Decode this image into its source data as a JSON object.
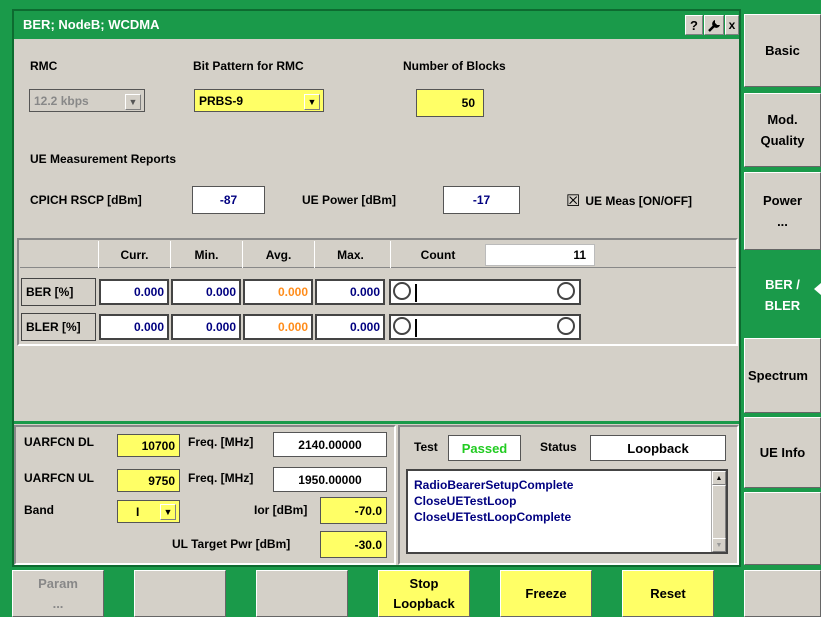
{
  "window": {
    "title": "BER; NodeB; WCDMA",
    "help_icon_glyph": "?",
    "close_glyph": "x"
  },
  "rmc": {
    "label": "RMC",
    "value": "12.2 kbps"
  },
  "bit_pattern": {
    "label": "Bit Pattern for RMC",
    "value": "PRBS-9"
  },
  "blocks": {
    "label": "Number of Blocks",
    "value": "50"
  },
  "ue_reports": {
    "title": "UE Measurement Reports",
    "cpich_label": "CPICH RSCP [dBm]",
    "cpich_value": "-87",
    "power_label": "UE Power [dBm]",
    "power_value": "-17",
    "meas_check": "☒",
    "meas_label": "UE Meas [ON/OFF]"
  },
  "results": {
    "headers": {
      "curr": "Curr.",
      "min": "Min.",
      "avg": "Avg.",
      "max": "Max.",
      "count": "Count"
    },
    "count_value": "11",
    "rows": [
      {
        "label": "BER  [%]",
        "curr": "0.000",
        "min": "0.000",
        "avg": "0.000",
        "max": "0.000"
      },
      {
        "label": "BLER  [%]",
        "curr": "0.000",
        "min": "0.000",
        "avg": "0.000",
        "max": "0.000"
      }
    ]
  },
  "rf": {
    "uarfcn_dl_label": "UARFCN DL",
    "uarfcn_dl": "10700",
    "freq_dl_label": "Freq. [MHz]",
    "freq_dl": "2140.00000",
    "uarfcn_ul_label": "UARFCN UL",
    "uarfcn_ul": "9750",
    "freq_ul_label": "Freq. [MHz]",
    "freq_ul": "1950.00000",
    "band_label": "Band",
    "band_value": "I",
    "ior_label": "Ior [dBm]",
    "ior_value": "-70.0",
    "ul_target_label": "UL Target Pwr [dBm]",
    "ul_target_value": "-30.0"
  },
  "test": {
    "test_label": "Test",
    "test_value": "Passed",
    "status_label": "Status",
    "status_value": "Loopback",
    "log": [
      "RadioBearerSetupComplete",
      "CloseUETestLoop",
      "CloseUETestLoopComplete"
    ]
  },
  "sidebar": [
    {
      "label": "Basic"
    },
    {
      "label": "Mod.\nQuality"
    },
    {
      "label": "Power\n..."
    },
    {
      "label": "BER /\nBLER"
    },
    {
      "label": "Spectrum"
    },
    {
      "label": "UE Info"
    },
    {
      "label": ""
    }
  ],
  "softkeys": [
    {
      "label": "Param\n..."
    },
    {
      "label": ""
    },
    {
      "label": ""
    },
    {
      "label": "Stop\nLoopback"
    },
    {
      "label": "Freeze"
    },
    {
      "label": "Reset"
    },
    {
      "label": ""
    }
  ],
  "colors": {
    "accent_green": "#1a9a4a",
    "highlight_yellow": "#ffff66",
    "passed_green": "#22cc22",
    "avg_orange": "#ff8c1a"
  }
}
